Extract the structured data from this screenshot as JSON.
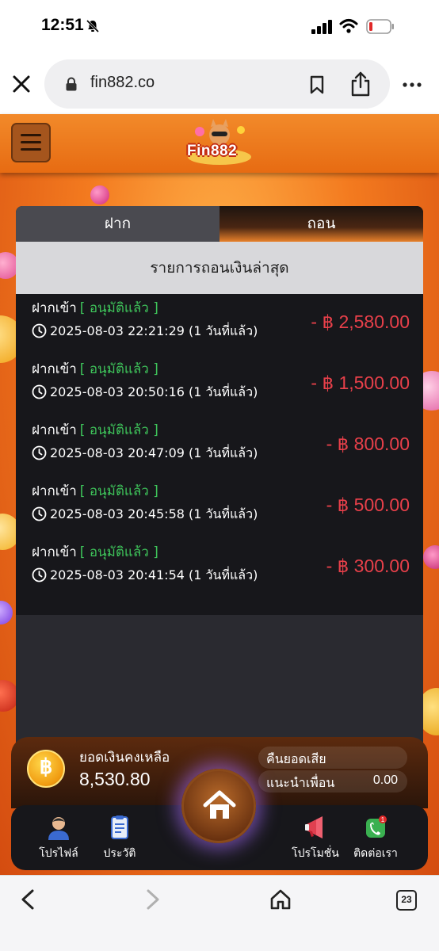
{
  "status_bar": {
    "time": "12:51"
  },
  "browser": {
    "url": "fin882.co",
    "tab_count": "23"
  },
  "site": {
    "logo_text": "Fin882"
  },
  "tabs": {
    "deposit": "ฝาก",
    "withdraw": "ถอน",
    "active": "withdraw"
  },
  "list": {
    "heading": "รายการถอนเงินล่าสุด",
    "transactions": [
      {
        "type": "ฝากเข้า",
        "status": "[ อนุมัติแล้ว ]",
        "time": "2025-08-03 22:21:29 (1 วันที่แล้ว)",
        "amount": "- ฿ 2,580.00"
      },
      {
        "type": "ฝากเข้า",
        "status": "[ อนุมัติแล้ว ]",
        "time": "2025-08-03 20:50:16 (1 วันที่แล้ว)",
        "amount": "- ฿ 1,500.00"
      },
      {
        "type": "ฝากเข้า",
        "status": "[ อนุมัติแล้ว ]",
        "time": "2025-08-03 20:47:09 (1 วันที่แล้ว)",
        "amount": "- ฿ 800.00"
      },
      {
        "type": "ฝากเข้า",
        "status": "[ อนุมัติแล้ว ]",
        "time": "2025-08-03 20:45:58 (1 วันที่แล้ว)",
        "amount": "- ฿ 500.00"
      },
      {
        "type": "ฝากเข้า",
        "status": "[ อนุมัติแล้ว ]",
        "time": "2025-08-03 20:41:54 (1 วันที่แล้ว)",
        "amount": "- ฿ 300.00"
      }
    ]
  },
  "balance": {
    "coin_symbol": "฿",
    "label": "ยอดเงินคงเหลือ",
    "value": "8,530.80",
    "cashback_label": "คืนยอดเสีย",
    "referral_label": "แนะนำเพื่อน",
    "referral_value": "0.00"
  },
  "nav": {
    "profile": "โปรไฟล์",
    "history": "ประวัติ",
    "promotion": "โปรโมชั่น",
    "contact": "ติดต่อเรา"
  },
  "colors": {
    "header_orange": "#ec7a1e",
    "amount_red": "#e8404a",
    "status_green": "#3ec35a",
    "panel_dark": "#17171b"
  },
  "icons": {
    "status": [
      "bell-off-icon",
      "signal-icon",
      "wifi-icon",
      "battery-icon"
    ],
    "browser": [
      "close-icon",
      "lock-icon",
      "bookmark-icon",
      "share-icon",
      "more-icon"
    ],
    "toolbar": [
      "back-icon",
      "forward-icon",
      "home-icon",
      "tabs-icon"
    ]
  }
}
